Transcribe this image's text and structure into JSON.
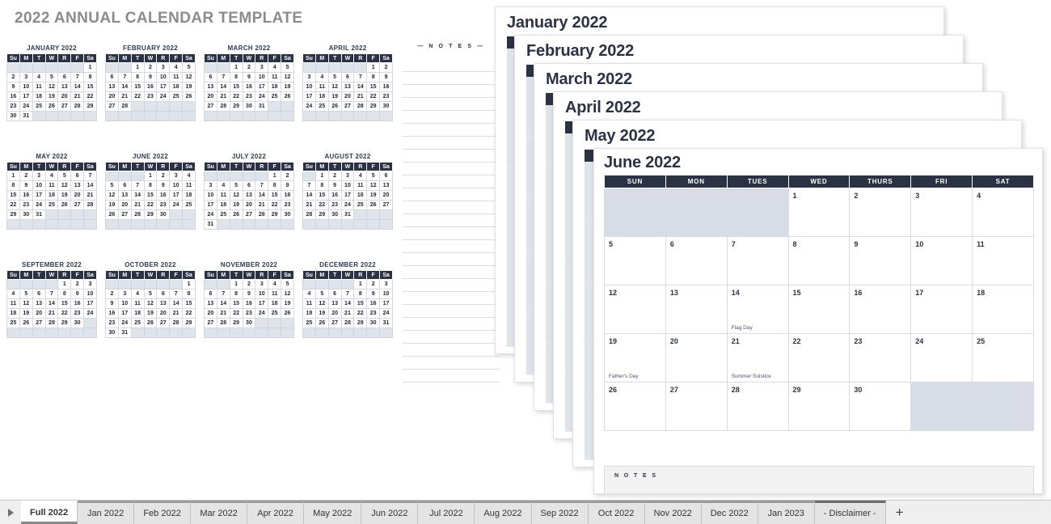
{
  "page_title": "2022 ANNUAL CALENDAR TEMPLATE",
  "colors": {
    "header_navy": "#2b3244",
    "shade_blue": "#d8dde5",
    "title_gray": "#8b8b8b",
    "grid_line": "#d9dde3"
  },
  "annual_notes": {
    "title": "— N O T E S —",
    "line_count": 25
  },
  "mini_weekday_headers": [
    "Su",
    "M",
    "T",
    "W",
    "R",
    "F",
    "Sa"
  ],
  "mini_calendars": [
    {
      "title": "JANUARY 2022",
      "lead_blanks": 6,
      "days": 31
    },
    {
      "title": "FEBRUARY 2022",
      "lead_blanks": 2,
      "days": 28
    },
    {
      "title": "MARCH 2022",
      "lead_blanks": 2,
      "days": 31
    },
    {
      "title": "APRIL 2022",
      "lead_blanks": 5,
      "days": 30
    },
    {
      "title": "MAY 2022",
      "lead_blanks": 0,
      "days": 31
    },
    {
      "title": "JUNE 2022",
      "lead_blanks": 3,
      "days": 30
    },
    {
      "title": "JULY 2022",
      "lead_blanks": 5,
      "days": 31
    },
    {
      "title": "AUGUST 2022",
      "lead_blanks": 1,
      "days": 31
    },
    {
      "title": "SEPTEMBER 2022",
      "lead_blanks": 4,
      "days": 30
    },
    {
      "title": "OCTOBER 2022",
      "lead_blanks": 6,
      "days": 31
    },
    {
      "title": "NOVEMBER 2022",
      "lead_blanks": 2,
      "days": 30
    },
    {
      "title": "DECEMBER 2022",
      "lead_blanks": 4,
      "days": 31
    }
  ],
  "month_weekday_headers": [
    "SUN",
    "MON",
    "TUES",
    "WED",
    "THURS",
    "FRI",
    "SAT"
  ],
  "stacked_pages": [
    {
      "title": "January 2022"
    },
    {
      "title": "February 2022"
    },
    {
      "title": "March 2022"
    },
    {
      "title": "April 2022"
    },
    {
      "title": "May 2022"
    }
  ],
  "front_page": {
    "title": "June 2022",
    "lead_blanks": 3,
    "days": 30,
    "trailing_blanks": 2,
    "events": {
      "14": "Flag Day",
      "19": "Father's Day",
      "21": "Summer Solstice"
    },
    "notes_label": "N O T E S"
  },
  "tabbar": {
    "nav_arrow": "play-right-icon",
    "add_label": "+",
    "active_tab": "Full 2022",
    "tabs": [
      "Full 2022",
      "Jan 2022",
      "Feb 2022",
      "Mar 2022",
      "Apr 2022",
      "May 2022",
      "Jun 2022",
      "Jul 2022",
      "Aug 2022",
      "Sep 2022",
      "Oct 2022",
      "Nov 2022",
      "Dec 2022",
      "Jan 2023",
      "- Disclaimer -"
    ]
  }
}
